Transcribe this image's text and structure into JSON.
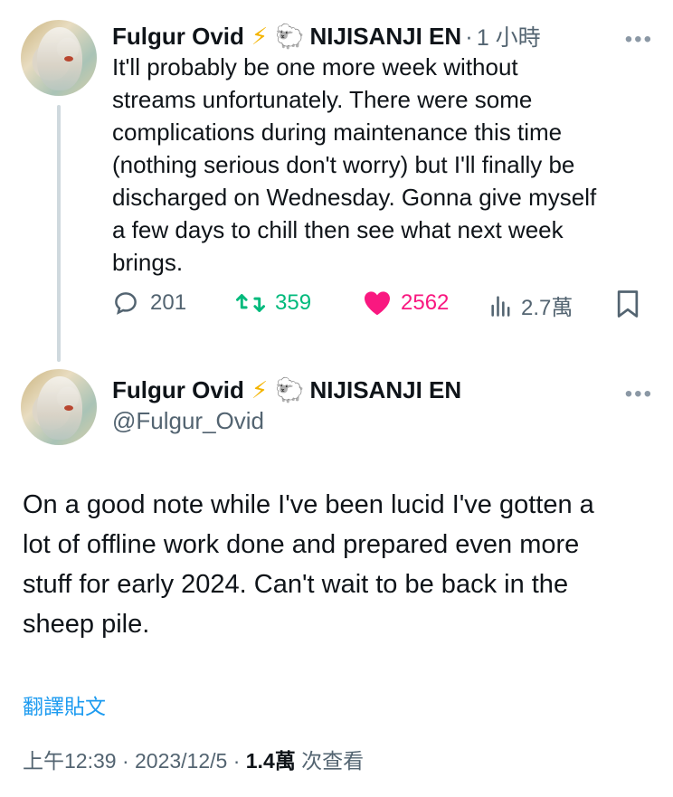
{
  "reply_tweet": {
    "display_name": "Fulgur Ovid",
    "emoji_bolt": "⚡",
    "emoji_sheep": "🐑",
    "affiliation": "NIJISANJI EN",
    "separator": "·",
    "time": "1 小時",
    "more": "•••",
    "text": "It'll probably be one more week without\nstreams unfortunately. There were some\ncomplications during maintenance this time\n(nothing serious don't worry) but I'll finally be\ndischarged on Wednesday. Gonna give myself\na few days to chill then see what next week\nbrings.",
    "actions": {
      "replies": "201",
      "retweets": "359",
      "likes": "2562",
      "views": "2.7萬"
    },
    "colors": {
      "retweet": "#00ba7c",
      "like": "#f91880",
      "muted": "#536471"
    }
  },
  "main_tweet": {
    "display_name": "Fulgur Ovid",
    "emoji_bolt": "⚡",
    "emoji_sheep": "🐑",
    "affiliation": "NIJISANJI EN",
    "handle": "@Fulgur_Ovid",
    "more": "•••",
    "text": "On a good note while I've been lucid I've gotten a\nlot of offline work done and prepared even more\nstuff for early 2024. Can't wait to be back in the\nsheep pile.",
    "translate_label": "翻譯貼文",
    "timestamp": "上午12:39 · 2023/12/5 · ",
    "views_count": "1.4萬",
    "views_label": " 次查看",
    "colors": {
      "link": "#1d9bf0"
    }
  }
}
